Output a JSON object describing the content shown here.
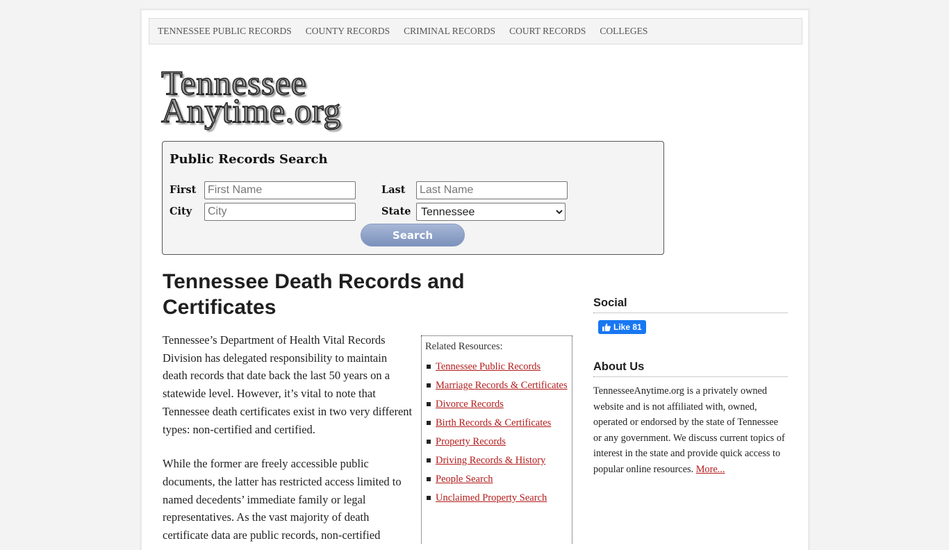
{
  "nav": {
    "items": [
      {
        "label": "TENNESSEE PUBLIC RECORDS"
      },
      {
        "label": "COUNTY RECORDS"
      },
      {
        "label": "CRIMINAL RECORDS"
      },
      {
        "label": "COURT RECORDS"
      },
      {
        "label": "COLLEGES"
      }
    ]
  },
  "logo": {
    "line1": "Tennessee",
    "line2": "Anytime.org"
  },
  "search": {
    "title": "Public Records Search",
    "first_label": "First",
    "first_placeholder": "First Name",
    "last_label": "Last",
    "last_placeholder": "Last Name",
    "city_label": "City",
    "city_placeholder": "City",
    "state_label": "State",
    "state_value": "Tennessee",
    "button_label": "Search"
  },
  "article": {
    "title": "Tennessee Death Records and Certificates",
    "paragraphs": [
      "Tennessee’s Department of Health Vital Records Division has delegated responsibility to maintain death records that date back the last 50 years on a statewide level. However, it’s vital to note that Tennessee death certificates exist in two very different types: non-certified and certified.",
      "While the former are freely accessible public documents, the latter has restricted access limited to named decedents’ immediate family or legal representatives. As the vast majority of death certificate data are public records, non-certified"
    ]
  },
  "related": {
    "title": "Related Resources:",
    "links": [
      {
        "label": "Tennessee Public Records"
      },
      {
        "label": "Marriage Records & Certificates"
      },
      {
        "label": "Divorce Records"
      },
      {
        "label": "Birth Records & Certificates"
      },
      {
        "label": "Property Records"
      },
      {
        "label": "Driving Records & History"
      },
      {
        "label": "People Search"
      },
      {
        "label": "Unclaimed Property Search"
      }
    ]
  },
  "sidebar": {
    "social_title": "Social",
    "like_label": "Like",
    "like_count": "81",
    "about_title": "About Us",
    "about_text": "TennesseeAnytime.org is a privately owned website and is not affiliated with, owned, operated or endorsed by the state of Tennessee or any government. We discuss current topics of interest in the state and provide quick access to popular online resources. ",
    "about_more": "More..."
  },
  "colors": {
    "link": "#b31b1b",
    "facebook": "#1877f2",
    "search_button": "#8ea1c9"
  }
}
